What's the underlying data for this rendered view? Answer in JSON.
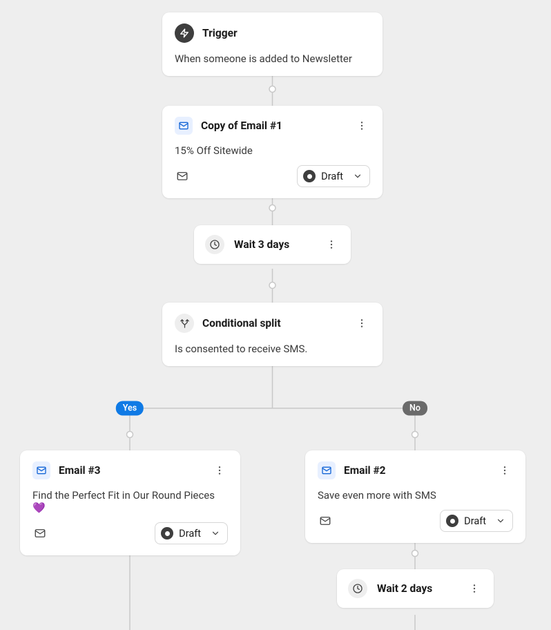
{
  "trigger": {
    "title": "Trigger",
    "desc": "When someone is added to Newsletter"
  },
  "email1": {
    "title": "Copy of Email #1",
    "desc": "15% Off Sitewide",
    "status": "Draft"
  },
  "wait1": {
    "title": "Wait 3 days"
  },
  "split": {
    "title": "Conditional split",
    "desc": "Is consented to receive SMS."
  },
  "branch": {
    "yes_label": "Yes",
    "no_label": "No"
  },
  "email3": {
    "title": "Email #3",
    "desc": "Find the Perfect Fit in Our Round Pieces 💜",
    "status": "Draft"
  },
  "email2": {
    "title": "Email #2",
    "desc": "Save even more with SMS",
    "status": "Draft"
  },
  "wait2": {
    "title": "Wait 2 days"
  },
  "icons": {
    "bolt": "bolt-icon",
    "mail": "mail-icon",
    "clock": "clock-icon",
    "split": "split-icon",
    "more": "more-vertical-icon"
  }
}
